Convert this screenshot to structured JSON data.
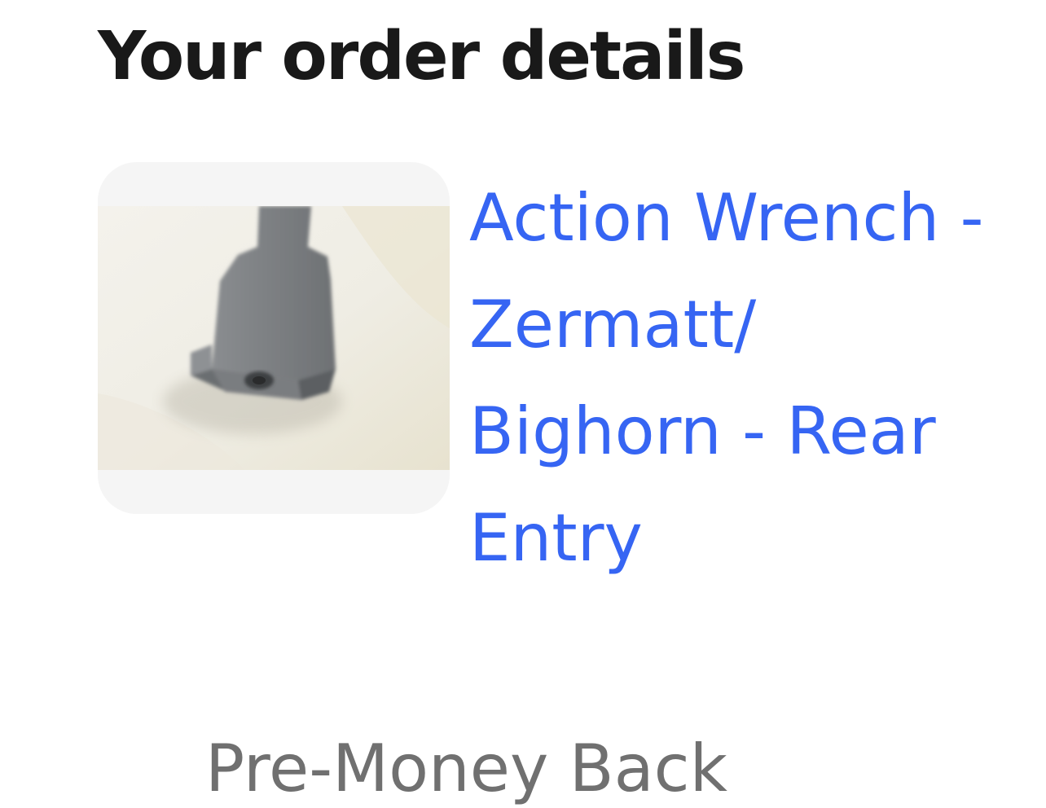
{
  "page": {
    "heading": "Your order details"
  },
  "order_item": {
    "image_alt": "Action wrench product photo",
    "title": "Action Wrench - Zermatt/ Bighorn - Rear Entry"
  },
  "cut_off_text": {
    "value": "Pre-Money Back"
  }
}
